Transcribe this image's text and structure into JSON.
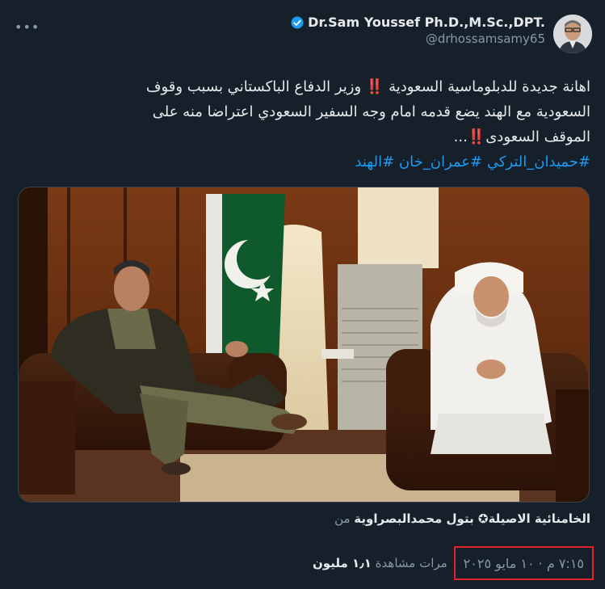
{
  "author": {
    "display_name": "Dr.Sam Youssef Ph.D.,M.Sc.,DPT.",
    "handle": "@drhossamsamy65"
  },
  "tweet": {
    "line1_text": "اهانة جديدة للدبلوماسية السعودية",
    "line1_emoji": "‼️",
    "line1_rest": "وزير الدفاع الباكستاني بسبب وقوف",
    "line2": "السعودية مع الهند يضع قدمه امام وجه السفير السعودي اعتراضا منه على",
    "line3_text": "الموقف السعودى",
    "line3_emoji": "‼️",
    "line3_end": "...",
    "hashtags": [
      "#حميدان_التركي",
      "#عمران_خان",
      "#الهند"
    ]
  },
  "attribution": {
    "prefix": "من",
    "source": "الخامنائية الاصيلة✪ بتول محمدالبصراوية"
  },
  "meta": {
    "timestamp": "٧:١٥ م · ١٠ مايو ٢٠٢٥",
    "separator": "·",
    "views_count": "١٫١ مليون",
    "views_label": "مرات مشاهدة"
  },
  "icons": {
    "more": "more-icon",
    "verified": "verified-badge-icon"
  },
  "colors": {
    "background": "#15202b",
    "link": "#1d9bf0",
    "muted": "#8b98a5",
    "highlight_box": "#e0262b"
  }
}
